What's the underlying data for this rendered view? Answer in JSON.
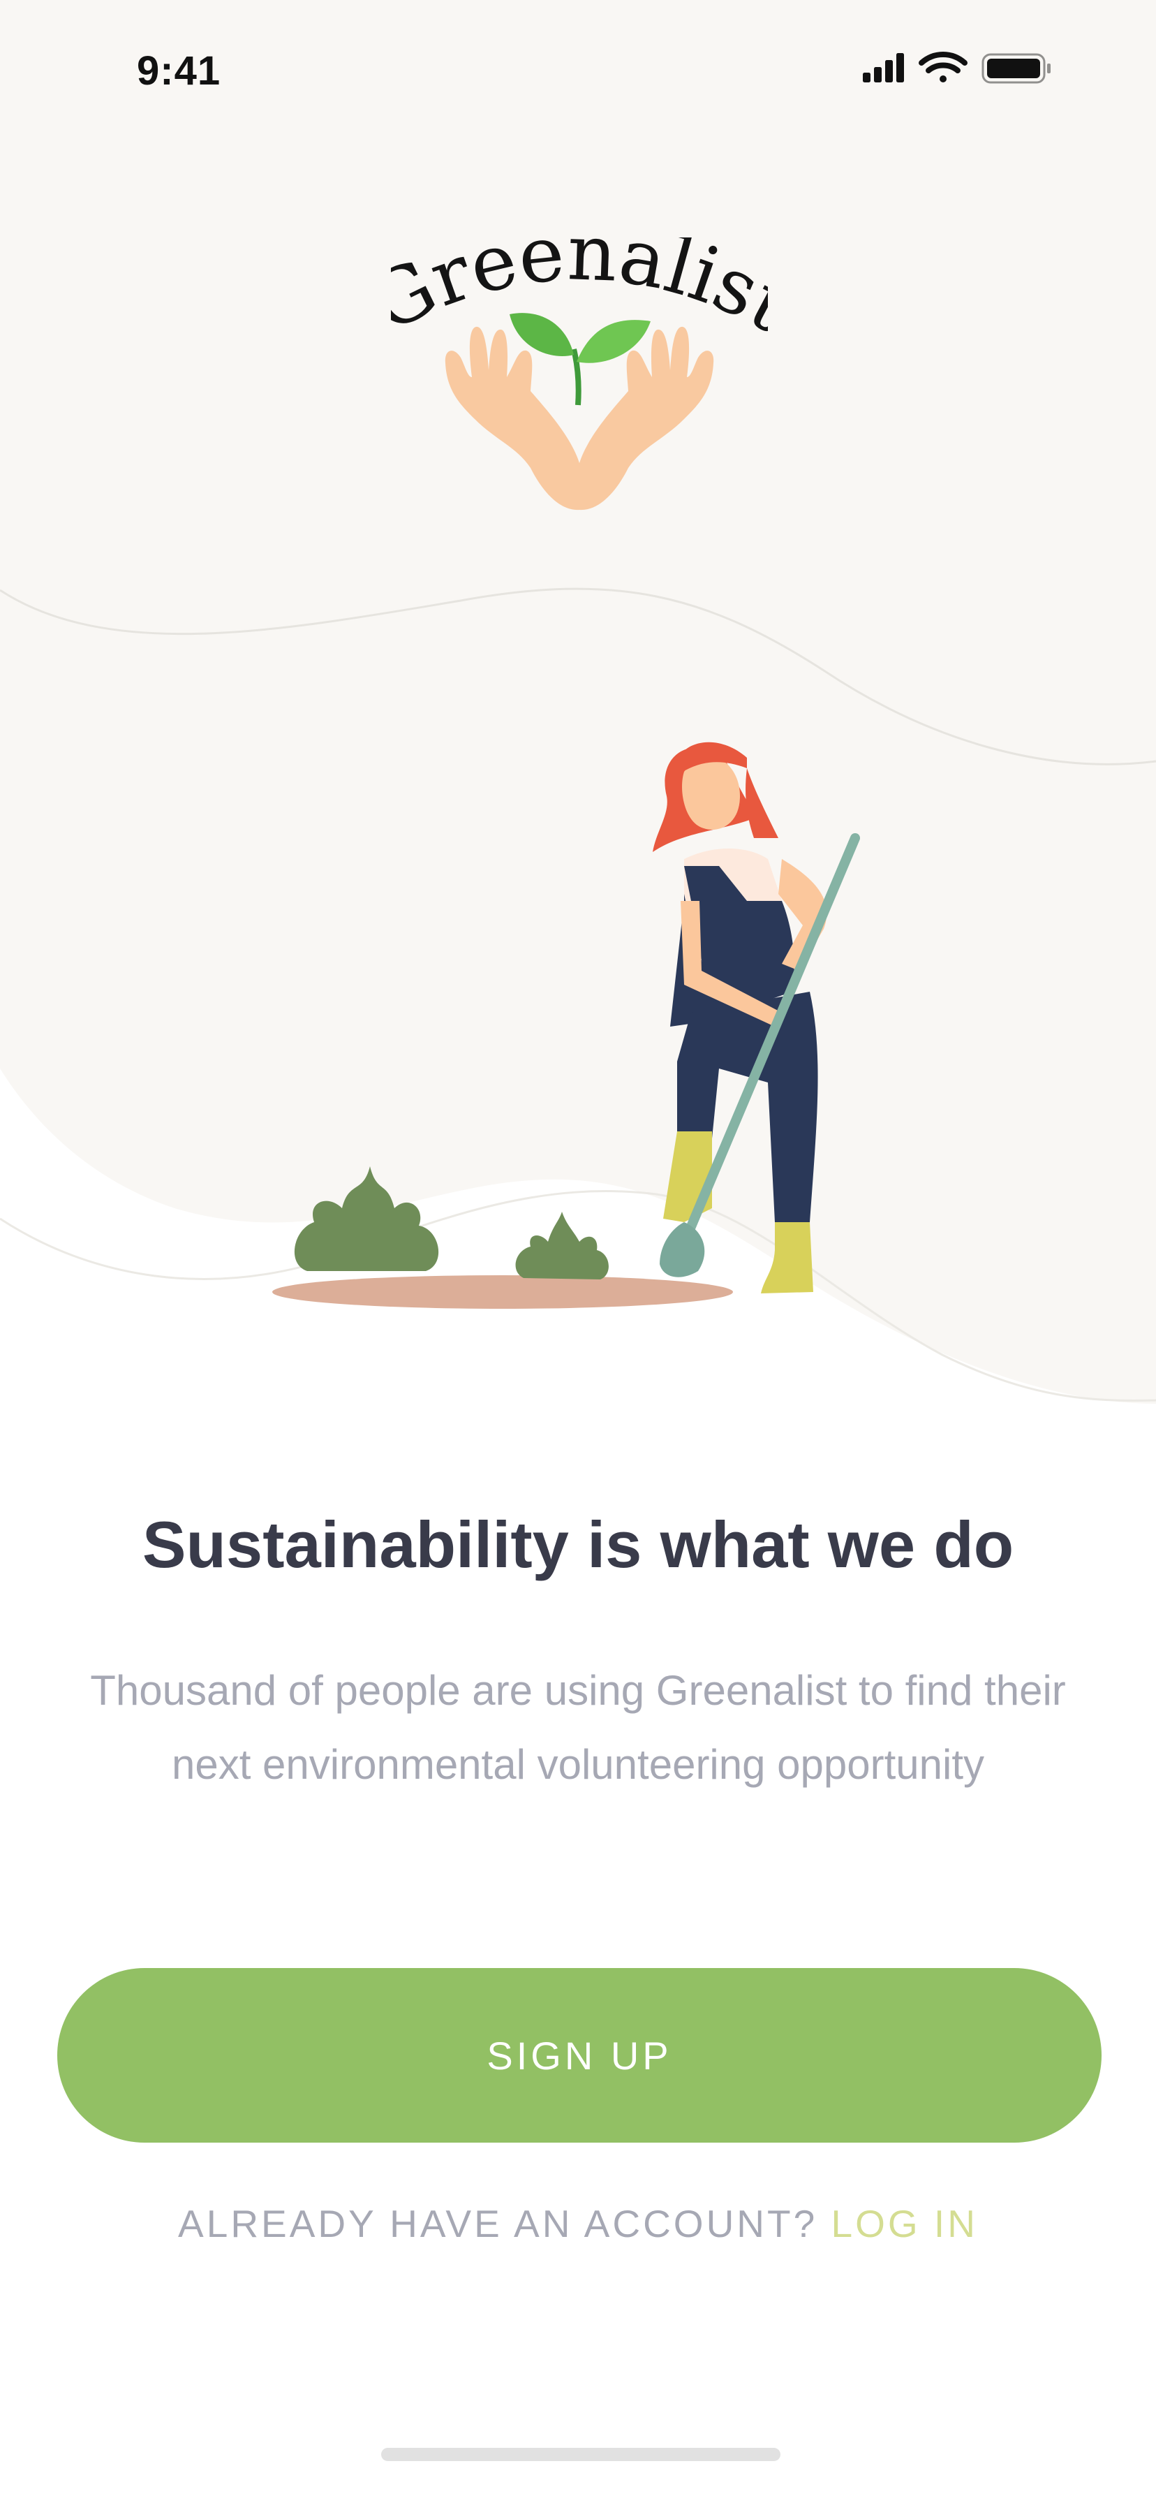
{
  "status_bar": {
    "time": "9:41"
  },
  "brand": {
    "logo_text": "Greenalist"
  },
  "onboarding": {
    "headline": "Sustainability is what we do",
    "subtext": "Thousand of people are using Greenalist to find their next environmental volunteering opportunity"
  },
  "actions": {
    "signup_label": "SIGN UP",
    "account_prompt": "ALREADY HAVE AN ACCOUNT?",
    "login_label": "LOG IN"
  },
  "colors": {
    "primary_green": "#92c064",
    "headline": "#393b4a",
    "muted_text": "#a6a8b4",
    "login_link": "#d4dd92",
    "background_cream": "#f9f7f4"
  },
  "icons": [
    "cellular-signal-icon",
    "wifi-icon",
    "battery-icon"
  ]
}
